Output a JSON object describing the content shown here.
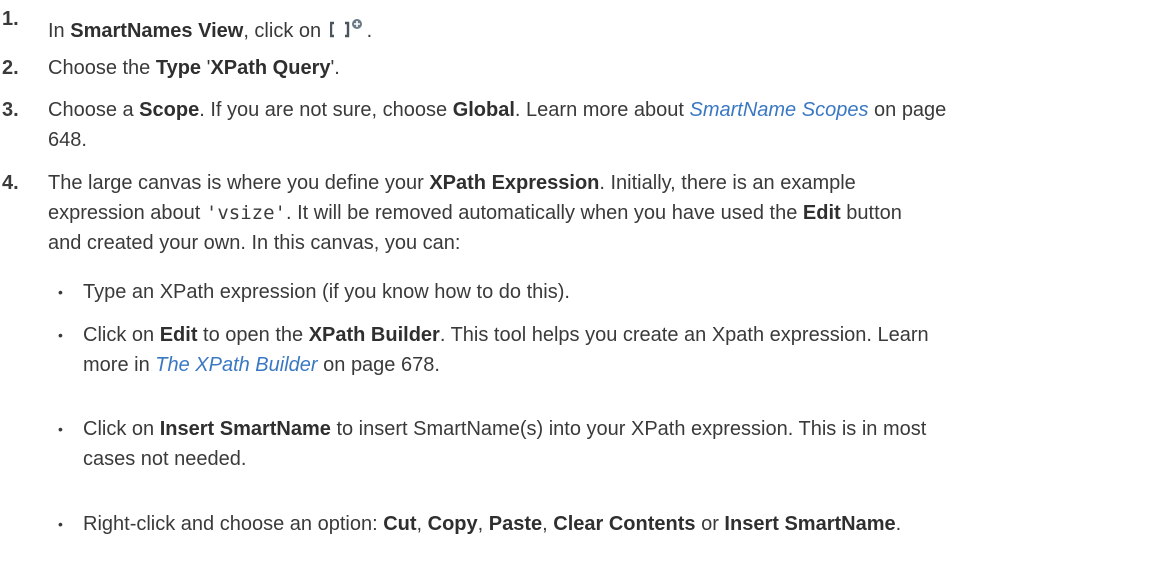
{
  "steps": [
    {
      "number": "1.",
      "pre": "In ",
      "b1": "SmartNames View",
      "mid": ", click on ",
      "icon": "add-smartname-icon",
      "post": "."
    },
    {
      "number": "2.",
      "pre": "Choose the ",
      "b1": "Type",
      "mid": " '",
      "b2": "XPath Query",
      "post": "'."
    },
    {
      "number": "3.",
      "pre": "Choose a ",
      "b1": "Scope",
      "mid": ". If you are not sure, choose ",
      "b2": "Global",
      "mid2": ". Learn more about ",
      "link": "SmartName Scopes",
      "post": " on page",
      "line2": "648."
    },
    {
      "number": "4.",
      "line1_pre": "The large canvas is where you define your ",
      "line1_b": "XPath Expression",
      "line1_post": ". Initially, there is an example",
      "line2_pre": "expression about ",
      "line2_code": "'vsize'",
      "line2_mid": ". It will be removed automatically when you have used the ",
      "line2_b": "Edit",
      "line2_post": " button",
      "line3": "and created your own. In this canvas, you can:"
    }
  ],
  "bullets": [
    {
      "symbol": "•",
      "text": "Type an XPath expression (if you know how to do this)."
    },
    {
      "symbol": "•",
      "pre": "Click on ",
      "b1": "Edit",
      "mid": " to open the ",
      "b2": "XPath Builder",
      "post": ". This tool helps you create an Xpath expression. Learn",
      "line2_pre": "more in ",
      "link": "The XPath Builder",
      "line2_post": "  on page 678."
    },
    {
      "symbol": "•",
      "pre": "Click on ",
      "b1": "Insert SmartName",
      "post": " to insert SmartName(s) into your XPath expression. This is in most",
      "line2": "cases not needed."
    },
    {
      "symbol": "•",
      "pre": "Right-click and choose an option: ",
      "b1": "Cut",
      "s1": ", ",
      "b2": "Copy",
      "s2": ", ",
      "b3": "Paste",
      "s3": ", ",
      "b4": "Clear Contents",
      "s4": " or ",
      "b5": "Insert SmartName",
      "post": "."
    }
  ],
  "colors": {
    "text": "#3a3a3a",
    "link": "#3a78c3",
    "icon": "#5a6670"
  }
}
